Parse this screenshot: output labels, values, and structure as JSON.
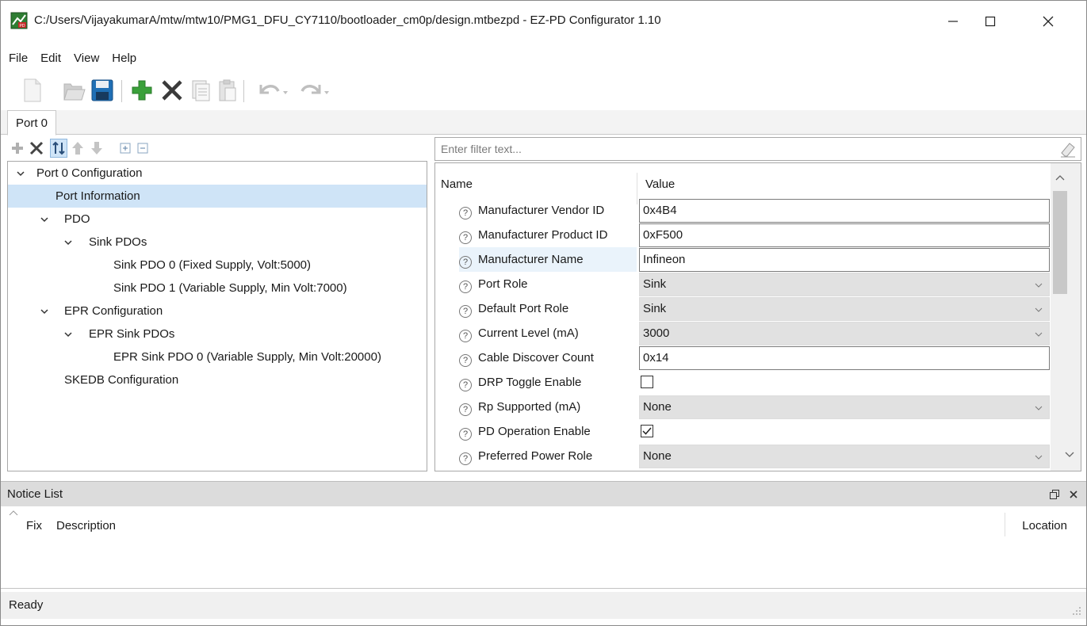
{
  "window": {
    "title": "C:/Users/VijayakumarA/mtw/mtw10/PMG1_DFU_CY7110/bootloader_cm0p/design.mtbezpd - EZ-PD Configurator 1.10",
    "app_icon": "ez-pd-configurator-icon",
    "controls": [
      "minimize-icon",
      "maximize-icon",
      "close-icon"
    ]
  },
  "menu": [
    {
      "label": "File"
    },
    {
      "label": "Edit"
    },
    {
      "label": "View"
    },
    {
      "label": "Help"
    }
  ],
  "toolbar": {
    "buttons": [
      "new-icon",
      "open-icon",
      "save-icon",
      "add-icon",
      "delete-icon",
      "copy-icon",
      "paste-icon",
      "undo-icon",
      "redo-icon"
    ]
  },
  "tabs": [
    {
      "label": "Port 0",
      "active": true
    }
  ],
  "tree_toolbar": {
    "buttons": [
      "add-icon",
      "delete-icon",
      "sort-icon",
      "move-up-icon",
      "move-down-icon",
      "expand-all-icon",
      "collapse-all-icon"
    ]
  },
  "tree": {
    "items": [
      {
        "label": "Port 0 Configuration",
        "level": 0,
        "expanded": true
      },
      {
        "label": "Port Information",
        "level": 1,
        "selected": true
      },
      {
        "label": "PDO",
        "level": 1,
        "expanded": true
      },
      {
        "label": "Sink PDOs",
        "level": 2,
        "expanded": true
      },
      {
        "label": "Sink PDO 0 (Fixed Supply, Volt:5000)",
        "level": 3
      },
      {
        "label": "Sink PDO 1 (Variable Supply, Min Volt:7000)",
        "level": 3
      },
      {
        "label": "EPR Configuration",
        "level": 1,
        "expanded": true
      },
      {
        "label": "EPR Sink PDOs",
        "level": 2,
        "expanded": true
      },
      {
        "label": "EPR Sink PDO 0 (Variable Supply, Min Volt:20000)",
        "level": 3
      },
      {
        "label": "SKEDB Configuration",
        "level": 1
      }
    ]
  },
  "filter": {
    "placeholder": "Enter filter text..."
  },
  "grid": {
    "columns": {
      "name": "Name",
      "value": "Value"
    },
    "help_glyph": "?",
    "rows": [
      {
        "name": "Manufacturer Vendor ID",
        "type": "text",
        "value": "0x4B4"
      },
      {
        "name": "Manufacturer Product ID",
        "type": "text",
        "value": "0xF500"
      },
      {
        "name": "Manufacturer Name",
        "type": "text",
        "value": "Infineon",
        "highlight": true
      },
      {
        "name": "Port Role",
        "type": "select",
        "value": "Sink"
      },
      {
        "name": "Default Port Role",
        "type": "select",
        "value": "Sink"
      },
      {
        "name": "Current Level (mA)",
        "type": "select",
        "value": "3000"
      },
      {
        "name": "Cable Discover Count",
        "type": "text",
        "value": "0x14"
      },
      {
        "name": "DRP Toggle Enable",
        "type": "checkbox",
        "checked": false
      },
      {
        "name": "Rp Supported (mA)",
        "type": "select",
        "value": "None"
      },
      {
        "name": "PD Operation Enable",
        "type": "checkbox",
        "checked": true
      },
      {
        "name": "Preferred Power Role",
        "type": "select",
        "value": "None"
      }
    ]
  },
  "notice": {
    "title": "Notice List",
    "columns": {
      "fix": "Fix",
      "description": "Description",
      "location": "Location"
    }
  },
  "status": {
    "text": "Ready"
  }
}
